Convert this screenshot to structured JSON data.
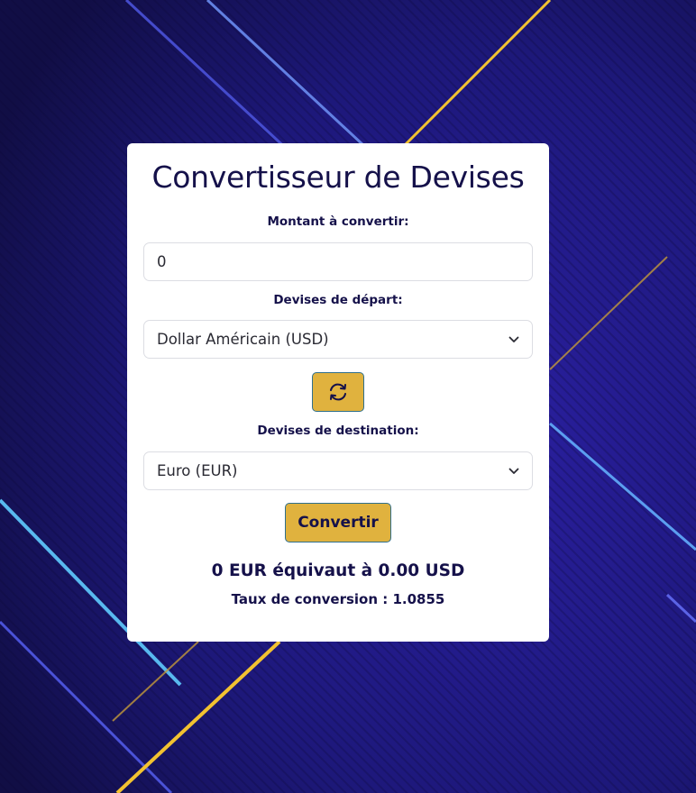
{
  "converter": {
    "title": "Convertisseur de Devises",
    "amount_label": "Montant à convertir:",
    "amount_value": "0",
    "from_label": "Devises de départ:",
    "from_selected": "Dollar Américain (USD)",
    "to_label": "Devises de destination:",
    "to_selected": "Euro (EUR)",
    "swap_icon": "swap-arrows-icon",
    "convert_label": "Convertir",
    "result_text": "0 EUR équivaut à 0.00 USD",
    "rate_text": "Taux de conversion : 1.0855"
  },
  "colors": {
    "background": "#1c1768",
    "card": "#ffffff",
    "text_dark": "#15114a",
    "button_gold": "#e0b23e",
    "button_border": "#2f6f8c",
    "accent_blue_line": "#5b63e6",
    "accent_gold_line": "#f2c230"
  }
}
